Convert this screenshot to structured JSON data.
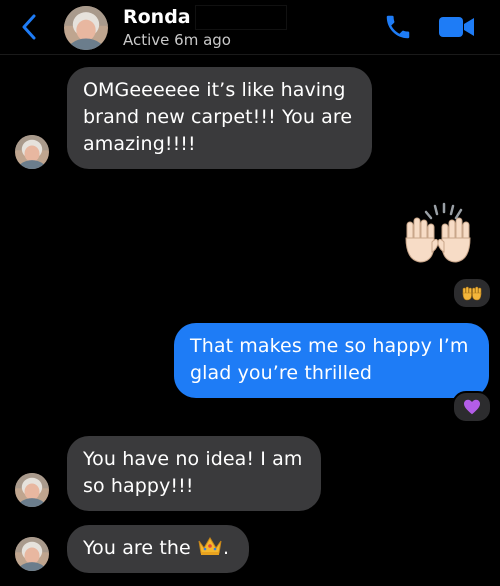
{
  "header": {
    "contact_name": "Ronda",
    "status": "Active 6m ago",
    "accent_color": "#1e7cf6"
  },
  "icons": {
    "back": "chevron-left-icon",
    "call": "phone-icon",
    "video": "video-camera-icon",
    "raised_hands": "raised-hands-emoji",
    "purple_heart": "purple-heart-emoji",
    "crown": "crown-emoji"
  },
  "messages": [
    {
      "sender": "Ronda",
      "direction": "incoming",
      "text": "OMGeeeeee it’s like having brand new carpet!!! You are amazing!!!!"
    },
    {
      "sender": "me",
      "direction": "outgoing",
      "type": "emoji",
      "emoji": "raised-hands",
      "reaction": "raised-hands"
    },
    {
      "sender": "me",
      "direction": "outgoing",
      "text": "That makes me so happy I’m glad you’re thrilled",
      "reaction": "purple-heart"
    },
    {
      "sender": "Ronda",
      "direction": "incoming",
      "text": "You have no idea! I am so happy!!!"
    },
    {
      "sender": "Ronda",
      "direction": "incoming",
      "text_before": "You are the",
      "emoji": "crown",
      "text_after": "."
    }
  ],
  "colors": {
    "incoming_bubble": "#3a3a3c",
    "outgoing_bubble": "#1e7cf6",
    "background": "#000000"
  }
}
